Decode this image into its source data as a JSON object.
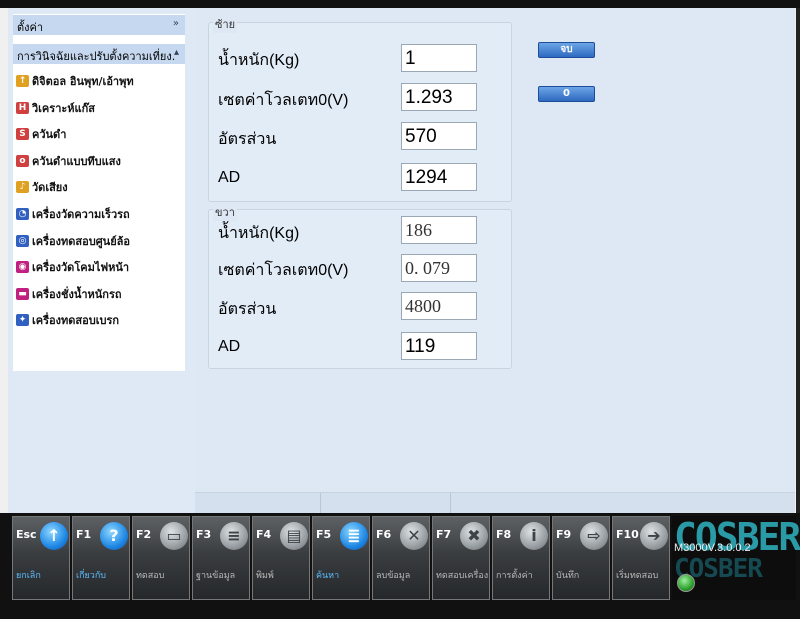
{
  "sidebar": {
    "header1": "ตั้งค่า",
    "header2": "การวินิจฉัยและปรับตั้งความเที่ยง.",
    "items": [
      {
        "label": "ดิจิตอล อินพุท/เอ้าพุท",
        "icon": "io-icon",
        "color": "#e0a020"
      },
      {
        "label": "วิเคราะห์แก๊ส",
        "icon": "gas-analyzer-icon",
        "color": "#d04040"
      },
      {
        "label": "ควันดำ",
        "icon": "smoke-icon",
        "color": "#d04040"
      },
      {
        "label": "ควันดำแบบทึบแสง",
        "icon": "opacity-smoke-icon",
        "color": "#d04040"
      },
      {
        "label": "วัดเสียง",
        "icon": "sound-icon",
        "color": "#e0a020"
      },
      {
        "label": "เครื่องวัดความเร็วรถ",
        "icon": "speedometer-icon",
        "color": "#3060c0"
      },
      {
        "label": "เครื่องทดสอบศูนย์ล้อ",
        "icon": "wheel-alignment-icon",
        "color": "#3060c0"
      },
      {
        "label": "เครื่องวัดโคมไฟหน้า",
        "icon": "headlight-icon",
        "color": "#c02080"
      },
      {
        "label": "เครื่องชั่งน้ำหนักรถ",
        "icon": "scale-icon",
        "color": "#c02080"
      },
      {
        "label": "เครื่องทดสอบเบรก",
        "icon": "brake-icon",
        "color": "#3060c0"
      }
    ]
  },
  "left_group": {
    "title": "ซ้าย",
    "weight_label": "น้ำหนัก(Kg)",
    "weight_value": "1",
    "zero_voltage_label": "เซตค่าโวลเตท0(V)",
    "zero_voltage_value": "1.293",
    "ratio_label": "อัตรส่วน",
    "ratio_value": "570",
    "ad_label": "AD",
    "ad_value": "1294"
  },
  "right_group": {
    "title": "ขวา",
    "weight_label": "น้ำหนัก(Kg)",
    "weight_value": "186",
    "zero_voltage_label": "เซตค่าโวลเตท0(V)",
    "zero_voltage_value": "0. 079",
    "ratio_label": "อัตรส่วน",
    "ratio_value": "4800",
    "ad_label": "AD",
    "ad_value": "119"
  },
  "buttons": {
    "save_label": "จบ",
    "zero_label": "0"
  },
  "function_keys": [
    {
      "code": "Esc",
      "label": "ยกเลิก",
      "icon": "up-arrow-icon",
      "blue": true
    },
    {
      "code": "F1",
      "label": "เกี่ยวกับ",
      "icon": "help-icon",
      "blue": true
    },
    {
      "code": "F2",
      "label": "ทดสอบ",
      "icon": "car-icon",
      "blue": false
    },
    {
      "code": "F3",
      "label": "ฐานข้อมูล",
      "icon": "database-icon",
      "blue": false
    },
    {
      "code": "F4",
      "label": "พิมพ์",
      "icon": "printer-icon",
      "blue": false
    },
    {
      "code": "F5",
      "label": "ค้นหา",
      "icon": "search-doc-icon",
      "blue": true
    },
    {
      "code": "F6",
      "label": "ลบข้อมูล",
      "icon": "trash-icon",
      "blue": false
    },
    {
      "code": "F7",
      "label": "ทดสอบเครื่อง",
      "icon": "tools-icon",
      "blue": false
    },
    {
      "code": "F8",
      "label": "การตั้งค่า",
      "icon": "settings-icon",
      "blue": false
    },
    {
      "code": "F9",
      "label": "บันทึก",
      "icon": "save-icon",
      "blue": false
    },
    {
      "code": "F10",
      "label": "เริ่มทดสอบ",
      "icon": "next-arrow-icon",
      "blue": false
    }
  ],
  "logo": {
    "brand": "COSBER",
    "version": "M3000V.3.0.0.2"
  }
}
